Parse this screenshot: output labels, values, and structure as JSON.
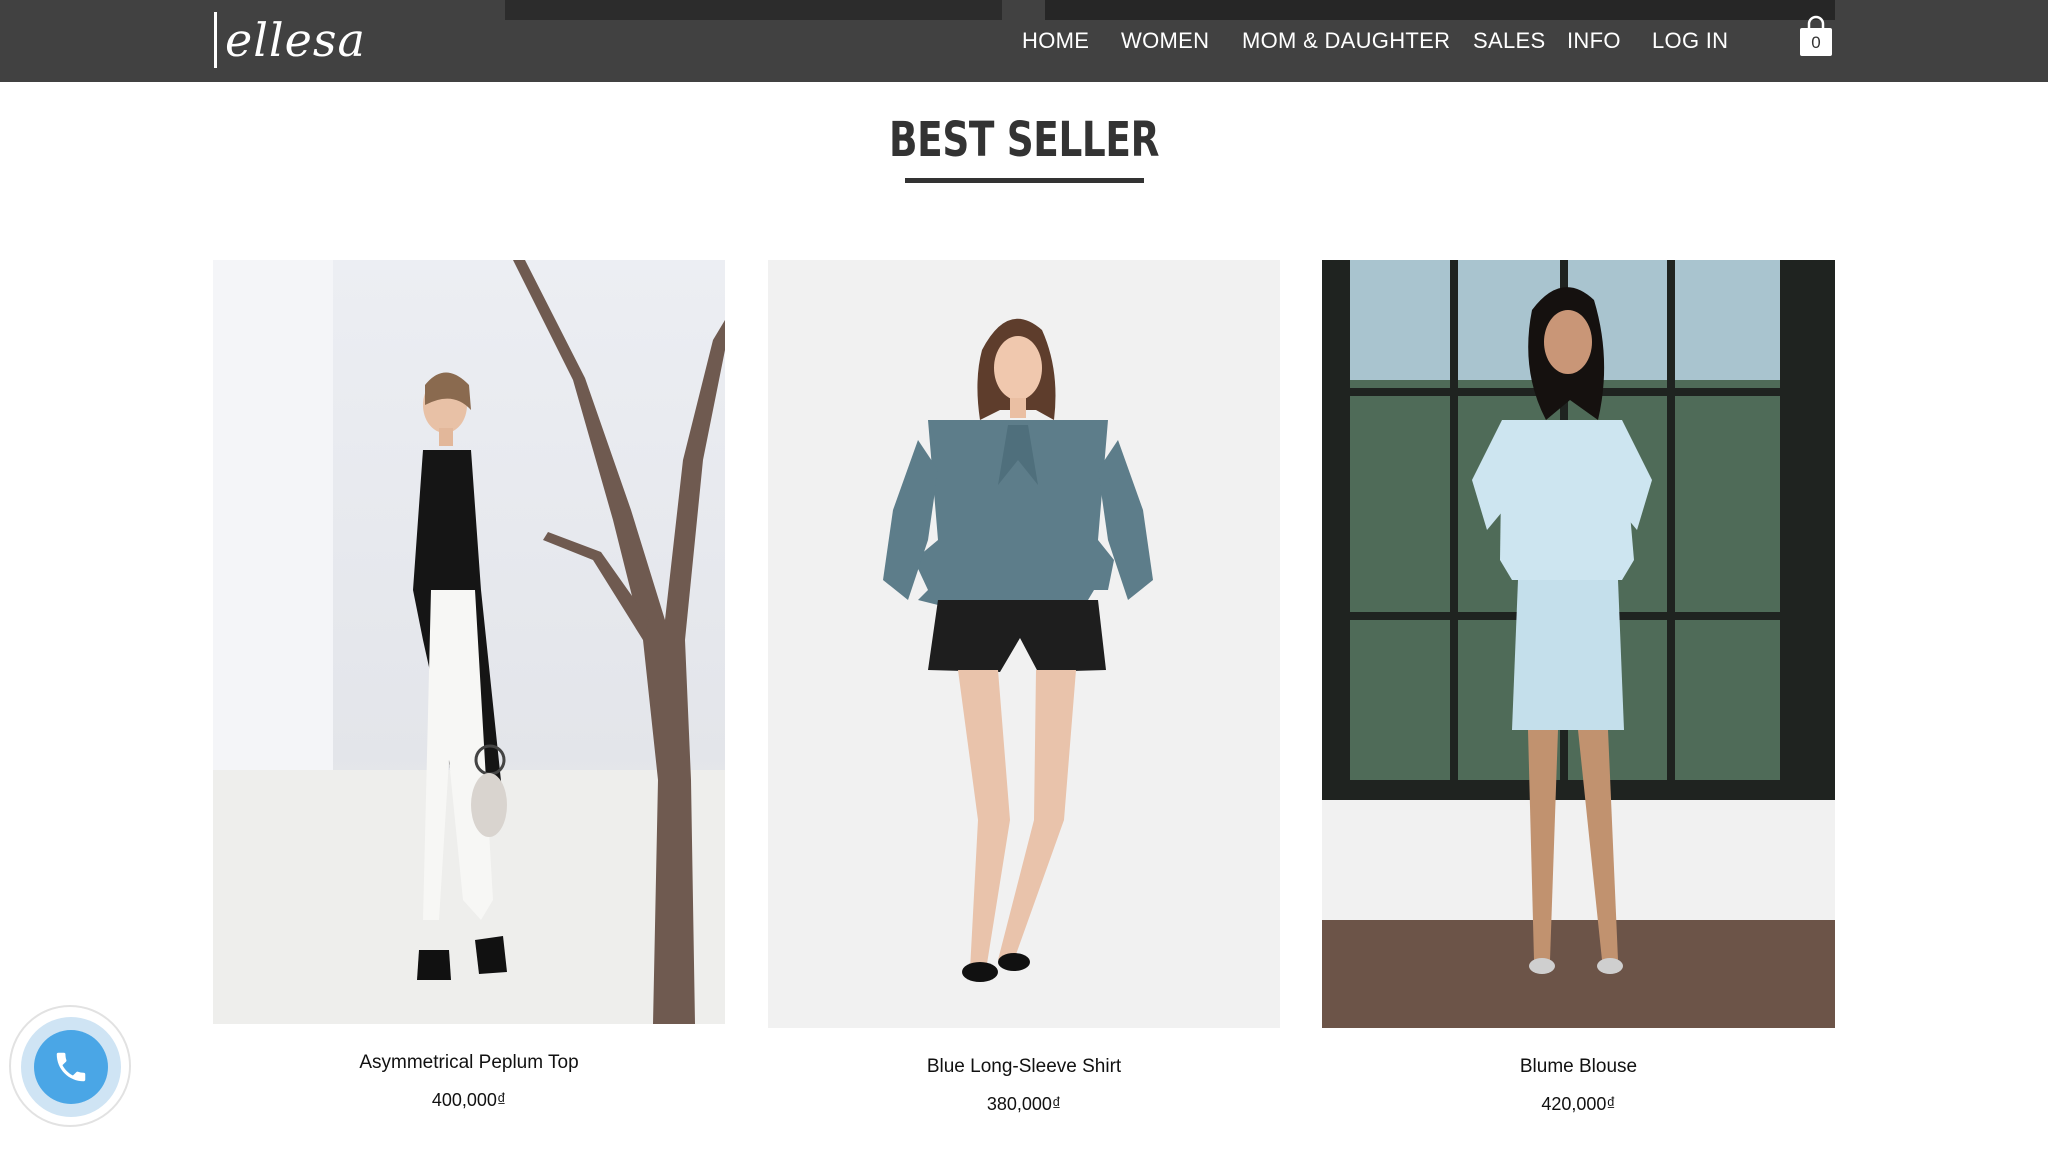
{
  "header": {
    "logo_text": "ellesa",
    "nav": [
      {
        "label": "HOME"
      },
      {
        "label": "WOMEN"
      },
      {
        "label": "MOM & DAUGHTER"
      },
      {
        "label": "SALES"
      },
      {
        "label": "INFO"
      },
      {
        "label": "LOG IN"
      }
    ],
    "cart": {
      "icon": "shopping-bag-icon",
      "count": "0"
    }
  },
  "section": {
    "title": "BEST SELLER"
  },
  "products": [
    {
      "name": "Asymmetrical Peplum Top",
      "price": "400,000₫"
    },
    {
      "name": "Blue Long-Sleeve Shirt",
      "price": "380,000₫"
    },
    {
      "name": "Blume Blouse",
      "price": "420,000₫"
    }
  ],
  "floating": {
    "call_icon": "phone-icon"
  },
  "colors": {
    "header_bg": "#414141",
    "accent_blue": "#4aa6e6",
    "text_dark": "#333333"
  }
}
